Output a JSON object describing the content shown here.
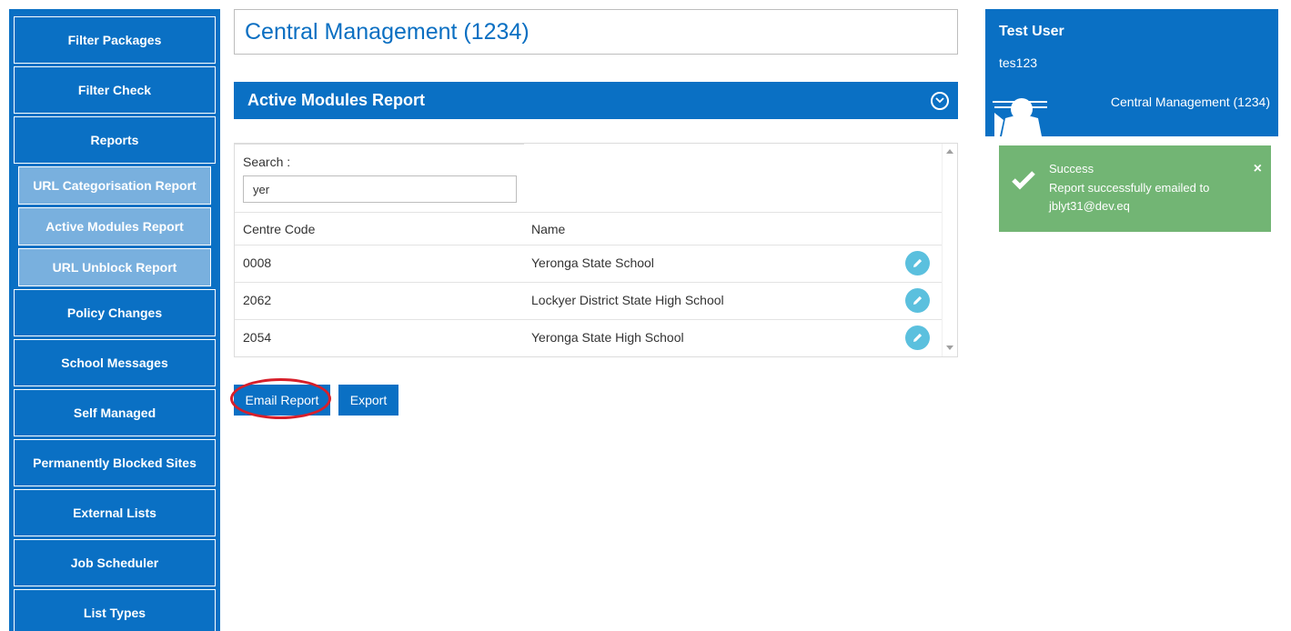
{
  "sidebar": {
    "items": [
      {
        "label": "Filter Packages"
      },
      {
        "label": "Filter Check"
      },
      {
        "label": "Reports"
      },
      {
        "label": "URL Categorisation Report"
      },
      {
        "label": "Active Modules Report"
      },
      {
        "label": "URL Unblock Report"
      },
      {
        "label": "Policy Changes"
      },
      {
        "label": "School Messages"
      },
      {
        "label": "Self Managed"
      },
      {
        "label": "Permanently Blocked Sites"
      },
      {
        "label": "External Lists"
      },
      {
        "label": "Job Scheduler"
      },
      {
        "label": "List Types"
      }
    ]
  },
  "page": {
    "title": "Central Management (1234)"
  },
  "panel": {
    "title": "Active Modules Report",
    "icon": "chevron-down-circle-icon"
  },
  "search": {
    "label": "Search :",
    "value": "yer"
  },
  "table": {
    "headers": [
      "Centre Code",
      "Name"
    ],
    "rows": [
      {
        "code": "0008",
        "name": "Yeronga State School"
      },
      {
        "code": "2062",
        "name": "Lockyer District State High School"
      },
      {
        "code": "2054",
        "name": "Yeronga State High School"
      }
    ]
  },
  "actions": {
    "email_label": "Email Report",
    "export_label": "Export"
  },
  "user": {
    "name": "Test User",
    "id": "tes123",
    "org": "Central Management (1234)"
  },
  "toast": {
    "title": "Success",
    "message": "Report successfully emailed to jblyt31@dev.eq",
    "close": "×"
  },
  "colors": {
    "primary": "#0a70c4",
    "submenu": "#79b0de",
    "success": "#72b574",
    "edit": "#5bc0de",
    "highlight": "#d71f2a"
  }
}
